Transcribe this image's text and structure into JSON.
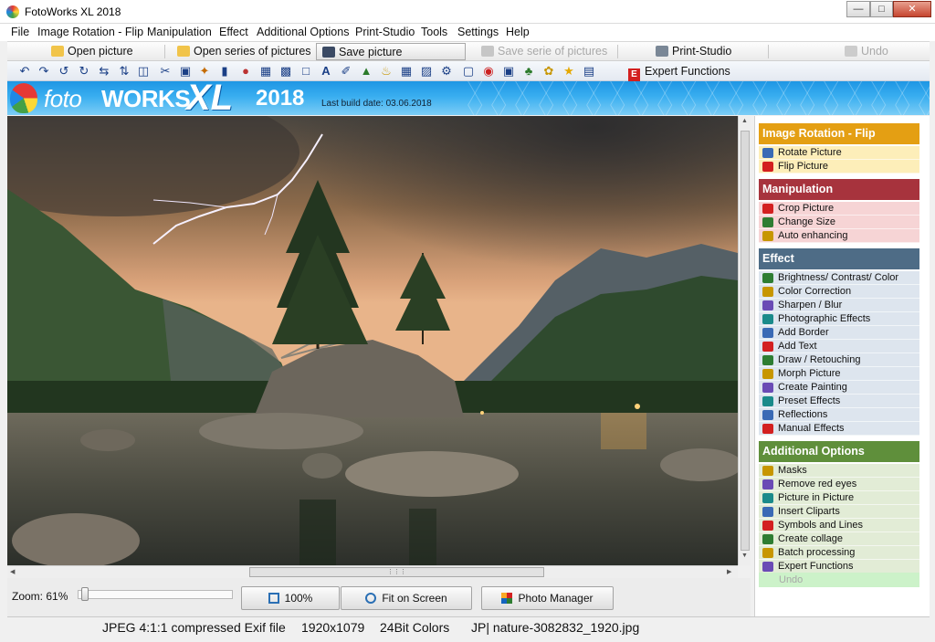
{
  "window": {
    "title": "FotoWorks XL 2018"
  },
  "menu": [
    "File",
    "Image Rotation - Flip",
    "Manipulation",
    "Effect",
    "Additional Options",
    "Print-Studio",
    "Tools",
    "Settings",
    "Help"
  ],
  "toolbar1": {
    "open_picture": "Open picture",
    "open_series": "Open series of pictures",
    "save_picture": "Save picture",
    "save_serie": "Save serie of pictures",
    "print_studio": "Print-Studio",
    "undo": "Undo"
  },
  "toolbar2": {
    "expert_functions": "Expert Functions"
  },
  "banner": {
    "foto": "foto",
    "works": "WORKS",
    "xl": "XL",
    "year": "2018",
    "build_date": "Last build date: 03.06.2018"
  },
  "zoom": {
    "label": "Zoom: 61%",
    "value_percent": 61
  },
  "bottom_buttons": {
    "hundred": "100%",
    "fit": "Fit on Screen",
    "manager": "Photo Manager"
  },
  "sidebar": {
    "sections": [
      {
        "title": "Image Rotation - Flip",
        "color": "#e49f13",
        "item_bg": "#fdeeb9",
        "items": [
          "Rotate Picture",
          "Flip Picture"
        ]
      },
      {
        "title": "Manipulation",
        "color": "#a7333d",
        "item_bg": "#f6d4d5",
        "items": [
          "Crop Picture",
          "Change Size",
          "Auto enhancing"
        ]
      },
      {
        "title": "Effect",
        "color": "#4e6c86",
        "item_bg": "#dde5ee",
        "items": [
          "Brightness/ Contrast/ Color",
          "Color Correction",
          "Sharpen / Blur",
          "Photographic Effects",
          "Add Border",
          "Add Text",
          "Draw / Retouching",
          "Morph Picture",
          "Create Painting",
          "Preset Effects",
          "Reflections",
          "Manual Effects"
        ]
      },
      {
        "title": "Additional Options",
        "color": "#5f8f3b",
        "item_bg": "#e2ecd6",
        "items": [
          "Masks",
          "Remove red eyes",
          "Picture in Picture",
          "Insert Cliparts",
          "Symbols and Lines",
          "Create collage",
          "Batch processing",
          "Expert Functions"
        ]
      }
    ],
    "undo": "Undo"
  },
  "status": {
    "format": "JPEG 4:1:1 compressed Exif file",
    "size": "1920x1079",
    "colors": "24Bit Colors",
    "filename": "JP| nature-3082832_1920.jpg"
  }
}
